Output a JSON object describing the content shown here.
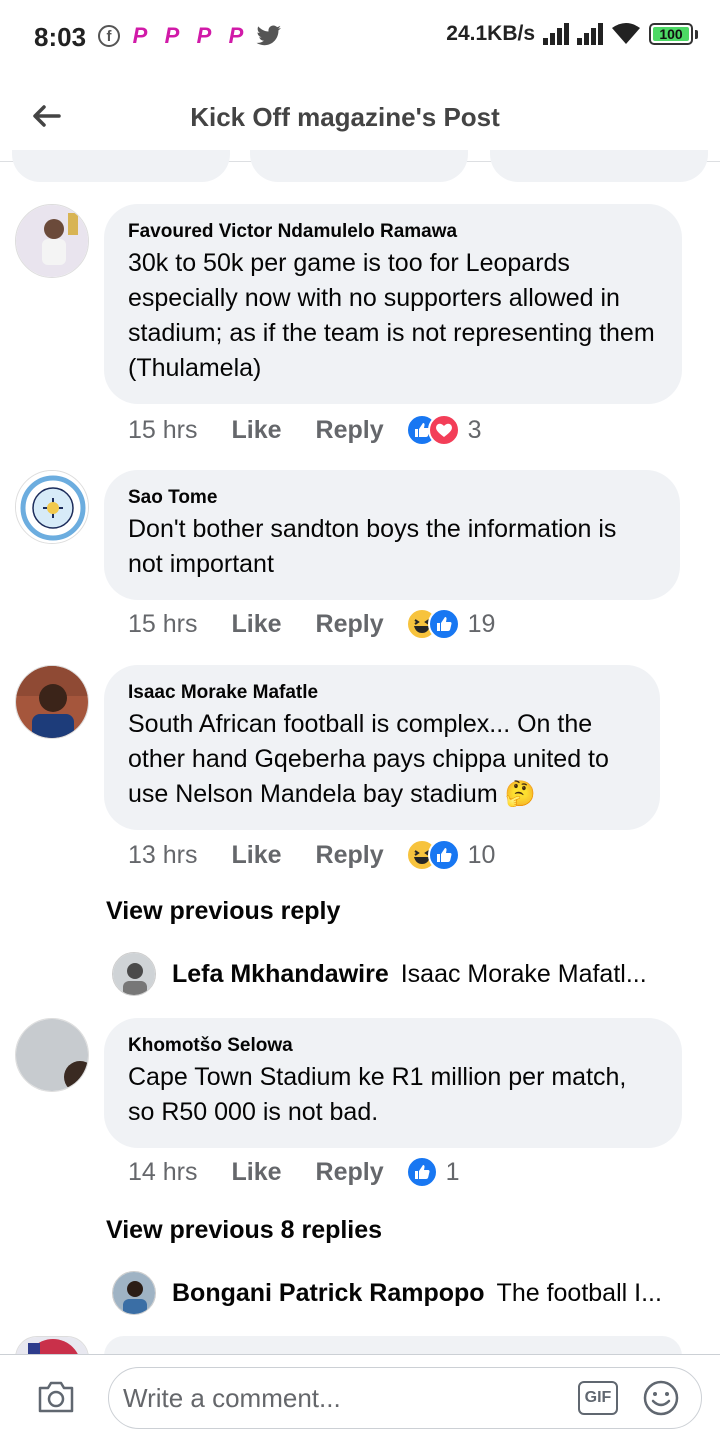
{
  "status_bar": {
    "time": "8:03",
    "net_speed": "24.1KB/s",
    "battery": "100"
  },
  "header": {
    "title": "Kick Off magazine's Post"
  },
  "comments": [
    {
      "author": "Favoured Victor Ndamulelo Ramawa",
      "text": "30k to 50k per game is too for Leopards especially now with no supporters allowed in stadium; as if the team is not representing them (Thulamela)",
      "time": "15 hrs",
      "like_label": "Like",
      "reply_label": "Reply",
      "reactions": [
        "like",
        "love"
      ],
      "reaction_count": "3"
    },
    {
      "author": "Sao Tome",
      "text": "Don't bother sandton boys the information is not important",
      "time": "15 hrs",
      "like_label": "Like",
      "reply_label": "Reply",
      "reactions": [
        "haha",
        "like"
      ],
      "reaction_count": "19"
    },
    {
      "author": "Isaac Morake Mafatle",
      "text": "South African football is complex... On the other hand Gqeberha pays chippa united to use Nelson Mandela bay stadium 🤔",
      "time": "13 hrs",
      "like_label": "Like",
      "reply_label": "Reply",
      "reactions": [
        "haha",
        "like"
      ],
      "reaction_count": "10",
      "view_previous": "View previous reply",
      "reply_preview": {
        "name": "Lefa Mkhandawire",
        "text": "Isaac Morake Mafatl..."
      }
    },
    {
      "author": "Khomotšo Selowa",
      "text": "Cape Town Stadium ke R1 million per match, so R50 000 is not bad.",
      "time": "14 hrs",
      "like_label": "Like",
      "reply_label": "Reply",
      "reactions": [
        "like"
      ],
      "reaction_count": "1",
      "view_previous": "View previous 8 replies",
      "reply_preview": {
        "name": "Bongani Patrick Rampopo",
        "text": "The football I..."
      }
    }
  ],
  "composer": {
    "placeholder": "Write a comment...",
    "gif_label": "GIF"
  },
  "colors": {
    "bubble": "#f0f2f5",
    "like_blue": "#1877f2",
    "love_red": "#f33e58",
    "haha_yellow": "#f7c33d",
    "meta_gray": "#65676b"
  }
}
